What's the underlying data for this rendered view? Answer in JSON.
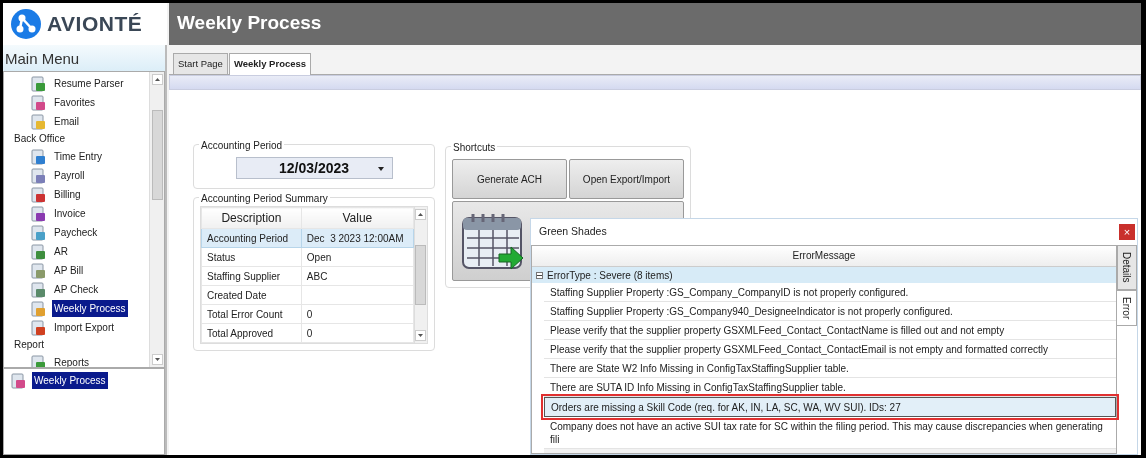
{
  "app": {
    "logo_text": "AVIONTÉ",
    "title": "Weekly Process"
  },
  "sidebar": {
    "title": "Main Menu",
    "tree": [
      {
        "children": [
          {
            "label": "Resume Parser",
            "selected": false
          },
          {
            "label": "Favorites",
            "selected": false
          },
          {
            "label": "Email",
            "selected": false
          }
        ]
      },
      {
        "label": "Back Office",
        "children": [
          {
            "label": "Time Entry",
            "selected": false
          },
          {
            "label": "Payroll",
            "selected": false
          },
          {
            "label": "Billing",
            "selected": false
          },
          {
            "label": "Invoice",
            "selected": false
          },
          {
            "label": "Paycheck",
            "selected": false
          },
          {
            "label": "AR",
            "selected": false
          },
          {
            "label": "AP Bill",
            "selected": false
          },
          {
            "label": "AP Check",
            "selected": false
          },
          {
            "label": "Weekly Process",
            "selected": true
          },
          {
            "label": "Import Export",
            "selected": false
          }
        ]
      },
      {
        "label": "Report",
        "children": [
          {
            "label": "Reports",
            "selected": false
          }
        ]
      }
    ],
    "recent": [
      {
        "label": "Weekly Process",
        "selected": true
      }
    ]
  },
  "tabs": [
    {
      "label": "Start Page",
      "selected": false
    },
    {
      "label": "Weekly Process",
      "selected": true
    }
  ],
  "accounting_period": {
    "title": "Accounting Period",
    "value": "12/03/2023"
  },
  "summary": {
    "title": "Accounting Period Summary",
    "columns": [
      "Description",
      "Value"
    ],
    "rows": [
      {
        "cells": [
          "Accounting Period",
          "Dec  3 2023 12:00AM"
        ],
        "selected": true
      },
      {
        "cells": [
          "Status",
          "Open"
        ],
        "selected": false
      },
      {
        "cells": [
          "Staffing Supplier",
          "ABC"
        ],
        "selected": false
      },
      {
        "cells": [
          "Created Date",
          ""
        ],
        "selected": false
      },
      {
        "cells": [
          "Total Error Count",
          "0"
        ],
        "selected": false
      },
      {
        "cells": [
          "Total Approved",
          "0"
        ],
        "selected": false
      }
    ]
  },
  "shortcuts": {
    "title": "Shortcuts",
    "buttons": [
      "Generate ACH",
      "Open Export/Import"
    ]
  },
  "dialog": {
    "title": "Green Shades",
    "close_label": "×",
    "column": "ErrorMessage",
    "group": {
      "label": "ErrorType : Severe (8 items)",
      "expanded": true
    },
    "rows": [
      {
        "text": "Staffing Supplier Property :GS_Company_CompanyID is not properly configured.",
        "selected": false,
        "highlighted": false
      },
      {
        "text": "Staffing Supplier Property :GS_Company940_DesigneeIndicator is not properly configured.",
        "selected": false,
        "highlighted": false
      },
      {
        "text": "Please verify that the supplier property GSXMLFeed_Contact_ContactName is filled out and not empty",
        "selected": false,
        "highlighted": false
      },
      {
        "text": "Please verify that the supplier property GSXMLFeed_Contact_ContactEmail is not empty and formatted correctly",
        "selected": false,
        "highlighted": false
      },
      {
        "text": "There are State W2 Info Missing in ConfigTaxStaffingSupplier table.",
        "selected": false,
        "highlighted": false
      },
      {
        "text": "There are SUTA ID Info Missing in ConfigTaxStaffingSupplier table.",
        "selected": false,
        "highlighted": false
      },
      {
        "text": "Orders are missing a Skill Code (req. for AK, IN, LA, SC, WA, WV SUI). IDs: 27",
        "selected": true,
        "highlighted": true
      },
      {
        "text": "Company does not have an active SUI tax rate for SC within the filing period.  This may cause discrepancies when generating fili",
        "selected": false,
        "highlighted": false
      }
    ],
    "side_tabs": [
      {
        "label": "Details",
        "selected": false
      },
      {
        "label": "Error",
        "selected": true
      }
    ]
  }
}
